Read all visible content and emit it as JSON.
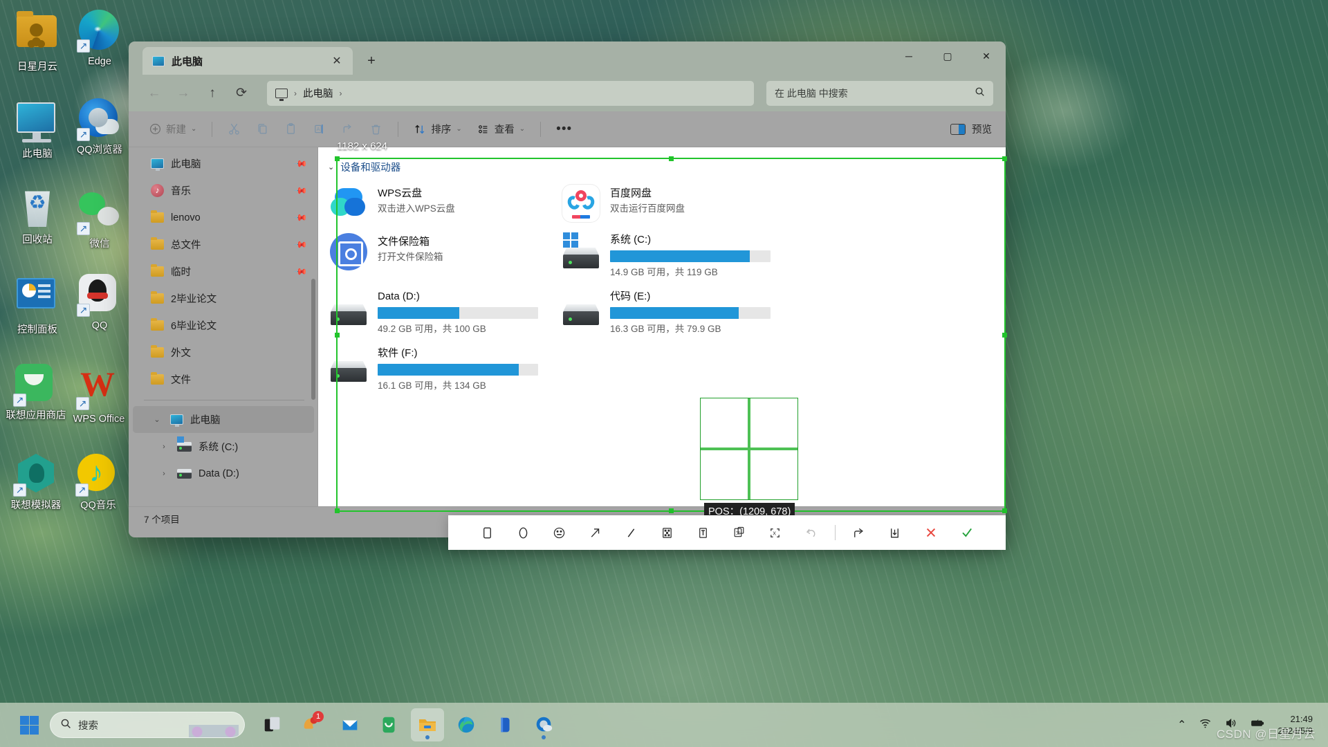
{
  "desktop": {
    "icons": [
      {
        "label": "日星月云",
        "icon": "user-folder-icon",
        "shortcut": false
      },
      {
        "label": "Edge",
        "icon": "edge-icon",
        "shortcut": true
      },
      {
        "label": "此电脑",
        "icon": "this-pc-icon",
        "shortcut": false
      },
      {
        "label": "QQ浏览器",
        "icon": "qq-browser-icon",
        "shortcut": true
      },
      {
        "label": "回收站",
        "icon": "recycle-bin-icon",
        "shortcut": false
      },
      {
        "label": "微信",
        "icon": "wechat-icon",
        "shortcut": true
      },
      {
        "label": "控制面板",
        "icon": "control-panel-icon",
        "shortcut": false
      },
      {
        "label": "QQ",
        "icon": "qq-icon",
        "shortcut": true
      },
      {
        "label": "联想应用商店",
        "icon": "lenovo-store-icon",
        "shortcut": true
      },
      {
        "label": "WPS Office",
        "icon": "wps-office-icon",
        "shortcut": true
      },
      {
        "label": "联想模拟器",
        "icon": "lenovo-emulator-icon",
        "shortcut": true
      },
      {
        "label": "QQ音乐",
        "icon": "qq-music-icon",
        "shortcut": true
      }
    ]
  },
  "explorer": {
    "tab": {
      "title": "此电脑",
      "close_label": "✕",
      "new_tab_label": "+"
    },
    "window_controls": {
      "minimize": "─",
      "maximize": "▢",
      "close": "✕"
    },
    "nav": {
      "back": "←",
      "forward": "→",
      "up": "↑",
      "refresh": "⟳",
      "breadcrumb": [
        "此电脑"
      ],
      "breadcrumb_sep": "›"
    },
    "search": {
      "placeholder": "在 此电脑 中搜索",
      "icon": "search-icon"
    },
    "toolbar": {
      "new_label": "新建",
      "cut": "cut-icon",
      "copy": "copy-icon",
      "paste": "paste-icon",
      "rename": "rename-icon",
      "share": "share-icon",
      "delete": "delete-icon",
      "sort_label": "排序",
      "view_label": "查看",
      "more_label": "•••",
      "preview_label": "预览"
    },
    "sidebar": {
      "quick": [
        {
          "label": "此电脑",
          "icon": "this-pc-icon",
          "pinned": true
        },
        {
          "label": "音乐",
          "icon": "music-icon",
          "pinned": true
        },
        {
          "label": "lenovo",
          "icon": "folder-icon",
          "pinned": true
        },
        {
          "label": "总文件",
          "icon": "folder-icon",
          "pinned": true
        },
        {
          "label": "临时",
          "icon": "folder-icon",
          "pinned": true
        },
        {
          "label": "2毕业论文",
          "icon": "folder-icon",
          "pinned": false
        },
        {
          "label": "6毕业论文",
          "icon": "folder-icon",
          "pinned": false
        },
        {
          "label": "外文",
          "icon": "folder-icon",
          "pinned": false
        },
        {
          "label": "文件",
          "icon": "folder-icon",
          "pinned": false
        }
      ],
      "tree": [
        {
          "label": "此电脑",
          "icon": "this-pc-icon",
          "chevron": "⌄",
          "selected": true,
          "indent": 0
        },
        {
          "label": "系统 (C:)",
          "icon": "windows-drive-icon",
          "chevron": "›",
          "selected": false,
          "indent": 1
        },
        {
          "label": "Data (D:)",
          "icon": "drive-icon",
          "chevron": "›",
          "selected": false,
          "indent": 1
        }
      ]
    },
    "content": {
      "group_title": "设备和驱动器",
      "group_chevron": "⌄",
      "cloud_items": [
        {
          "name": "WPS云盘",
          "sub": "双击进入WPS云盘",
          "icon": "wps-cloud-icon"
        },
        {
          "name": "百度网盘",
          "sub": "双击运行百度网盘",
          "icon": "baidu-netdisk-icon"
        },
        {
          "name": "文件保险箱",
          "sub": "打开文件保险箱",
          "icon": "file-safe-icon"
        }
      ],
      "drives": [
        {
          "name": "系统 (C:)",
          "free": "14.9 GB 可用，共 119 GB",
          "used_percent": 87,
          "icon": "windows-drive-icon"
        },
        {
          "name": "Data (D:)",
          "free": "49.2 GB 可用，共 100 GB",
          "used_percent": 51,
          "icon": "drive-icon"
        },
        {
          "name": "代码 (E:)",
          "free": "16.3 GB 可用，共 79.9 GB",
          "used_percent": 80,
          "icon": "drive-icon"
        },
        {
          "name": "软件 (F:)",
          "free": "16.1 GB 可用，共 134 GB",
          "used_percent": 88,
          "icon": "drive-icon"
        }
      ]
    },
    "status": {
      "count_label": "7 个项目"
    }
  },
  "capture": {
    "size_label": "1182 x 624",
    "pos_label": "POS：(1209, 678)",
    "accent_color": "#22c42c",
    "toolbar": [
      {
        "name": "rectangle-tool",
        "glyph": "rect"
      },
      {
        "name": "ellipse-tool",
        "glyph": "ellipse"
      },
      {
        "name": "emoji-tool",
        "glyph": "emoji"
      },
      {
        "name": "arrow-tool",
        "glyph": "arrow"
      },
      {
        "name": "pen-tool",
        "glyph": "pen"
      },
      {
        "name": "mosaic-tool",
        "glyph": "mosaic"
      },
      {
        "name": "text-tool",
        "glyph": "text"
      },
      {
        "name": "translate-tool",
        "glyph": "translate"
      },
      {
        "name": "ocr-tool",
        "glyph": "ocr"
      },
      {
        "name": "undo-tool",
        "glyph": "undo"
      },
      {
        "name": "separator",
        "glyph": "sep"
      },
      {
        "name": "share-tool",
        "glyph": "share"
      },
      {
        "name": "save-tool",
        "glyph": "save"
      },
      {
        "name": "cancel-tool",
        "glyph": "cancel"
      },
      {
        "name": "confirm-tool",
        "glyph": "confirm"
      }
    ]
  },
  "taskbar": {
    "search_placeholder": "搜索",
    "apps": [
      {
        "name": "task-view",
        "badge": null,
        "active": false
      },
      {
        "name": "paint",
        "badge": "1",
        "active": false
      },
      {
        "name": "mail",
        "badge": null,
        "active": false
      },
      {
        "name": "lenovo-store",
        "badge": null,
        "active": false
      },
      {
        "name": "file-explorer",
        "badge": null,
        "active": true
      },
      {
        "name": "edge",
        "badge": null,
        "active": false
      },
      {
        "name": "onedrive-blue",
        "badge": null,
        "active": false
      },
      {
        "name": "qq-browser",
        "badge": null,
        "active": false
      }
    ],
    "tray": {
      "chevron": "⌃",
      "wifi": "wifi-icon",
      "volume": "volume-icon",
      "battery": "battery-icon"
    },
    "clock": {
      "time": "21:49",
      "date": "2024/5/9"
    }
  },
  "watermark": {
    "text": "CSDN @日星月云"
  }
}
